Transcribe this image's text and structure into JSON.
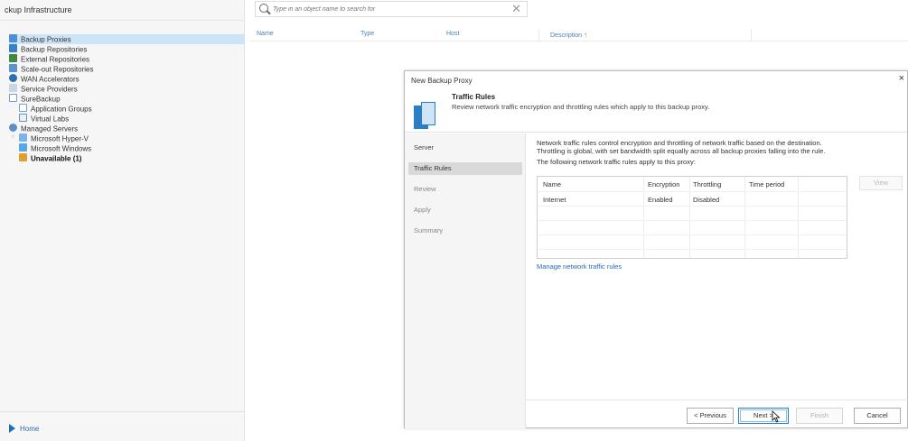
{
  "left_panel": {
    "title": "ckup Infrastructure",
    "items": [
      {
        "label": "Backup Proxies",
        "icon": "proxy-icon"
      },
      {
        "label": "Backup Repositories",
        "icon": "repository-icon"
      },
      {
        "label": "External Repositories",
        "icon": "external-repository-icon"
      },
      {
        "label": "Scale-out Repositories",
        "icon": "scaleout-repository-icon"
      },
      {
        "label": "WAN Accelerators",
        "icon": "wan-accelerator-icon"
      },
      {
        "label": "Service Providers",
        "icon": "service-provider-icon"
      },
      {
        "label": "SureBackup",
        "icon": "surebackup-icon"
      },
      {
        "label": "Application Groups",
        "icon": "application-group-icon"
      },
      {
        "label": "Virtual Labs",
        "icon": "virtual-lab-icon"
      },
      {
        "label": "Managed Servers",
        "icon": "managed-servers-icon"
      },
      {
        "label": "Microsoft Hyper-V",
        "icon": "hyperv-icon"
      },
      {
        "label": "Microsoft Windows",
        "icon": "windows-server-icon"
      },
      {
        "label": "Unavailable (1)",
        "icon": "unavailable-icon"
      }
    ],
    "home_label": "Home"
  },
  "search": {
    "placeholder": "Type in an object name to search for",
    "clear_icon": "close-icon"
  },
  "columns": {
    "name": "Name",
    "type": "Type",
    "host": "Host",
    "description": "Description",
    "sort_arrow": "↑"
  },
  "dialog": {
    "title": "New Backup Proxy",
    "close": "×",
    "header_title": "Traffic Rules",
    "header_subtitle": "Review network traffic encryption and throttling rules which apply to this backup proxy.",
    "steps": [
      "Server",
      "Traffic Rules",
      "Review",
      "Apply",
      "Summary"
    ],
    "description_line1": "Network traffic rules control encryption and throttling of network traffic based on the destination.",
    "description_line2": "Throttling is global, with set bandwidth split equally across all backup proxies falling into the rule.",
    "applies_text": "The following network traffic rules apply to this proxy:",
    "table": {
      "headers": [
        "Name",
        "Encryption",
        "Throttling",
        "Time period"
      ],
      "row": [
        "Internet",
        "Enabled",
        "Disabled",
        ""
      ]
    },
    "view_button": "View",
    "manage_link": "Manage network traffic rules",
    "buttons": {
      "previous": "< Previous",
      "next": "Next >",
      "finish": "Finish",
      "cancel": "Cancel"
    }
  },
  "colors": {
    "accent": "#2a7ec6",
    "selection": "#cce4f7",
    "link": "#2a6ab0",
    "sort_arrow": "#e05a1e"
  }
}
